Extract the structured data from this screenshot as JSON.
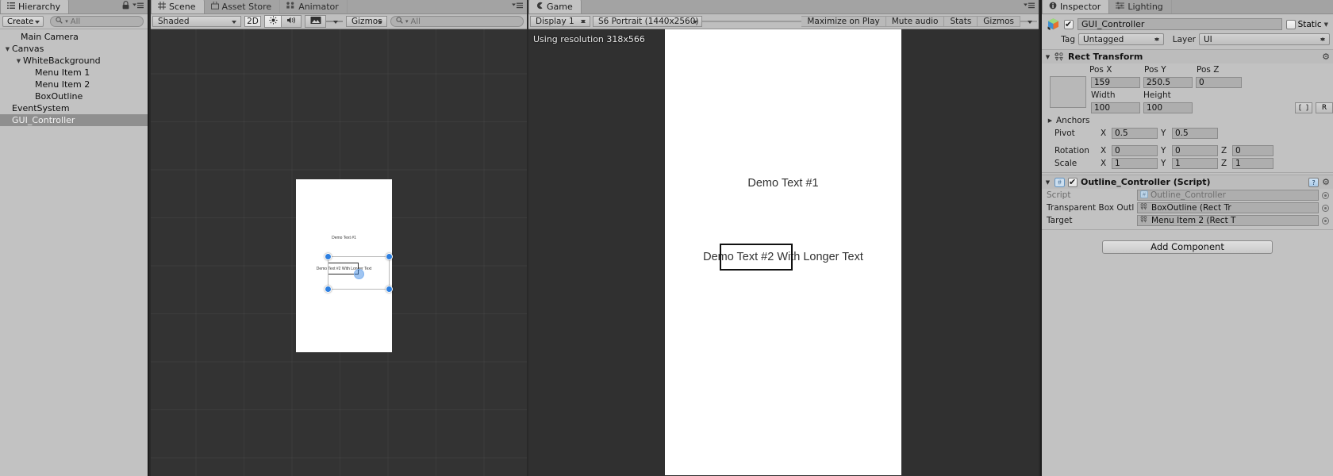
{
  "hierarchy": {
    "tab_label": "Hierarchy",
    "tab_icon": "hierarchy-icon",
    "lock_icon": "lock-icon",
    "menu_icon": "panel-menu-icon",
    "create_label": "Create",
    "search_placeholder": "All",
    "search_icon": "search-icon",
    "items": [
      {
        "label": "Main Camera",
        "depth": 1,
        "expander": "none",
        "selected": false
      },
      {
        "label": "Canvas",
        "depth": 0,
        "expander": "open",
        "selected": false
      },
      {
        "label": "WhiteBackground",
        "depth": 1,
        "expander": "open",
        "selected": false
      },
      {
        "label": "Menu Item 1",
        "depth": 2,
        "expander": "none",
        "selected": false
      },
      {
        "label": "Menu Item 2",
        "depth": 2,
        "expander": "none",
        "selected": false
      },
      {
        "label": "BoxOutline",
        "depth": 2,
        "expander": "none",
        "selected": false
      },
      {
        "label": "EventSystem",
        "depth": 0,
        "expander": "none",
        "selected": false
      },
      {
        "label": "GUI_Controller",
        "depth": 0,
        "expander": "none",
        "selected": true
      }
    ]
  },
  "scene": {
    "tabs": [
      {
        "label": "Scene",
        "icon": "grid-icon",
        "active": true
      },
      {
        "label": "Asset Store",
        "icon": "store-icon",
        "active": false
      },
      {
        "label": "Animator",
        "icon": "animator-icon",
        "active": false
      }
    ],
    "menu_icon": "panel-menu-icon",
    "toolbar": {
      "draw_mode": "Shaded",
      "two_d_label": "2D",
      "lighting_icon": "sun-icon",
      "audio_icon": "speaker-icon",
      "fx_icon": "image-icon",
      "gizmos_label": "Gizmos",
      "search_placeholder": "All",
      "search_icon": "search-icon"
    },
    "canvas": {
      "text1": "Demo Text #1",
      "text2": "Demo Text #2 With Longer Text"
    }
  },
  "game": {
    "tabs": [
      {
        "label": "Game",
        "icon": "gamepad-icon",
        "active": true
      }
    ],
    "menu_icon": "panel-menu-icon",
    "toolbar": {
      "display": "Display 1",
      "aspect": "S6 Portrait (1440x2560)",
      "maximize_on_play": "Maximize on Play",
      "mute_audio": "Mute audio",
      "stats": "Stats",
      "gizmos": "Gizmos"
    },
    "resolution_note": "Using resolution 318x566",
    "canvas": {
      "text1": "Demo Text #1",
      "text2": "Demo Text #2 With Longer Text"
    }
  },
  "inspector": {
    "tabs": [
      {
        "label": "Inspector",
        "icon": "info-icon",
        "active": true
      },
      {
        "label": "Lighting",
        "icon": "lighting-icon",
        "active": false
      }
    ],
    "menu_icon": "panel-menu-icon",
    "object": {
      "icon": "gameobject-cube-icon",
      "enabled": true,
      "name": "GUI_Controller",
      "static_label": "Static",
      "static_checked": false,
      "tag_label": "Tag",
      "tag_value": "Untagged",
      "layer_label": "Layer",
      "layer_value": "UI"
    },
    "rect_transform": {
      "title": "Rect Transform",
      "icon": "rect-transform-icon",
      "help_icon": "help-icon",
      "gear_icon": "gear-icon",
      "pos_x_label": "Pos X",
      "pos_x": "159",
      "pos_y_label": "Pos Y",
      "pos_y": "250.5",
      "pos_z_label": "Pos Z",
      "pos_z": "0",
      "width_label": "Width",
      "width": "100",
      "height_label": "Height",
      "height": "100",
      "blueprint_btn": "",
      "raw_btn": "R",
      "anchors_label": "Anchors",
      "pivot_label": "Pivot",
      "pivot_x": "0.5",
      "pivot_y": "0.5",
      "rotation_label": "Rotation",
      "rotation_x": "0",
      "rotation_y": "0",
      "rotation_z": "0",
      "scale_label": "Scale",
      "scale_x": "1",
      "scale_y": "1",
      "scale_z": "1",
      "axis_x": "X",
      "axis_y": "Y",
      "axis_z": "Z"
    },
    "script_component": {
      "title": "Outline_Controller (Script)",
      "icon": "cs-script-icon",
      "enabled": true,
      "help_icon": "help-icon",
      "gear_icon": "gear-icon",
      "script_label": "Script",
      "script_value": "Outline_Controller",
      "field1_label": "Transparent Box Outli",
      "field1_value": "BoxOutline (Rect Tr",
      "field2_label": "Target",
      "field2_value": "Menu Item 2 (Rect T"
    },
    "add_component_label": "Add Component"
  }
}
